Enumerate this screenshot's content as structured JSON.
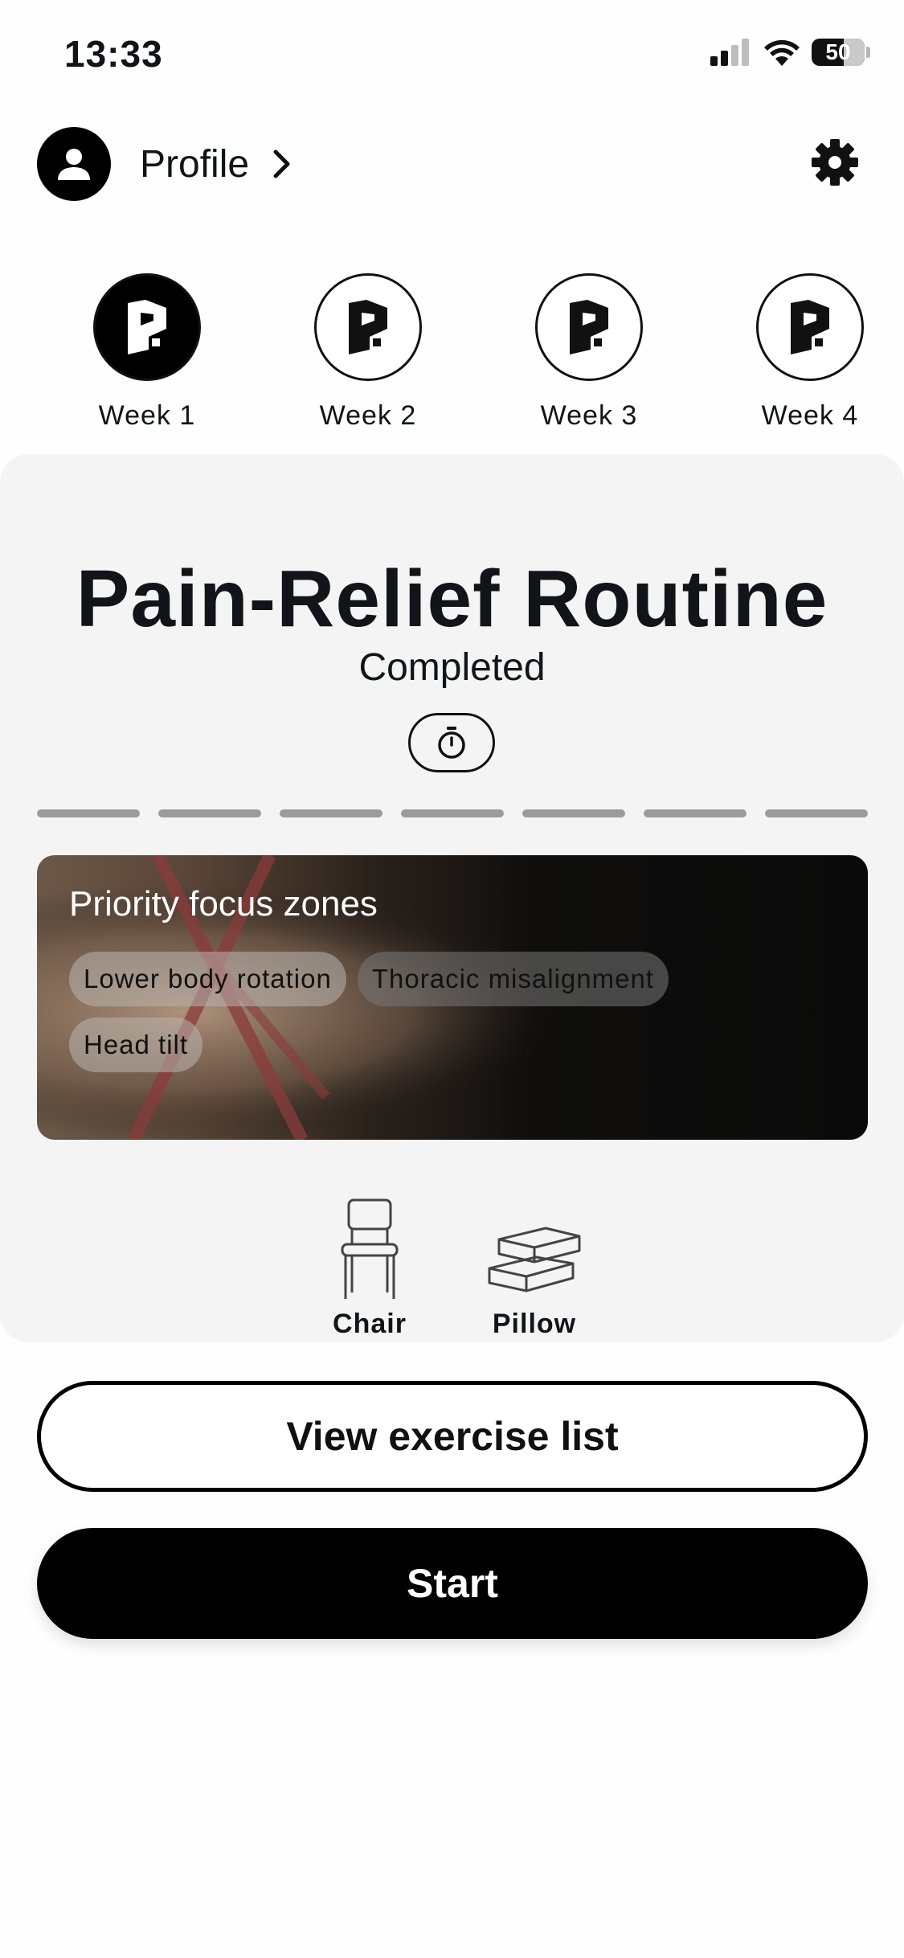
{
  "status_bar": {
    "time": "13:33",
    "battery": "50"
  },
  "header": {
    "profile_label": "Profile"
  },
  "weeks": [
    {
      "label": "Week 1",
      "active": true
    },
    {
      "label": "Week 2",
      "active": false
    },
    {
      "label": "Week 3",
      "active": false
    },
    {
      "label": "Week 4",
      "active": false
    }
  ],
  "routine": {
    "title": "Pain-Relief Routine",
    "status": "Completed",
    "segments_total": 7
  },
  "focus": {
    "title": "Priority focus zones",
    "chips": [
      "Lower body rotation",
      "Thoracic misalignment",
      "Head tilt"
    ]
  },
  "equipment": [
    {
      "label": "Chair",
      "icon": "chair-icon"
    },
    {
      "label": "Pillow",
      "icon": "pillow-icon"
    }
  ],
  "actions": {
    "view_list": "View exercise list",
    "start": "Start"
  },
  "colors": {
    "primary": "#000000",
    "card_bg": "#f4f4f4",
    "segment": "#9b9b9b"
  }
}
